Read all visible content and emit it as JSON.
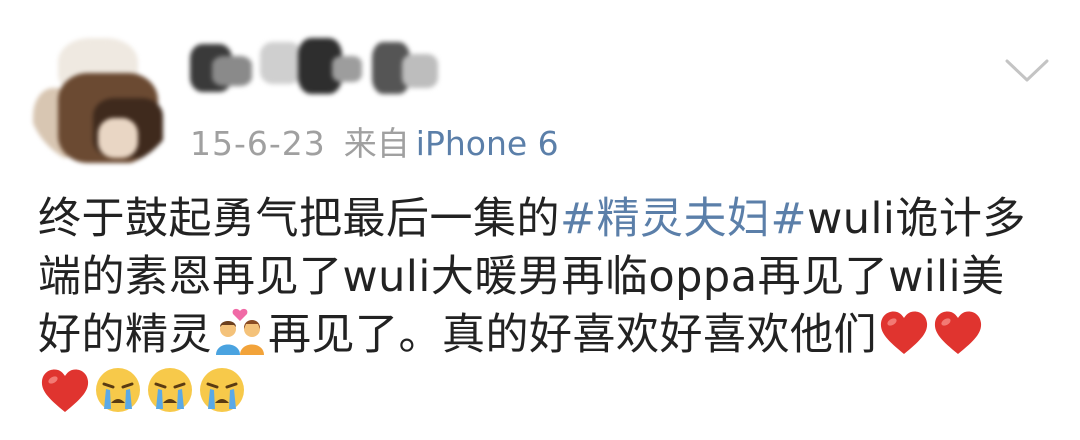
{
  "post": {
    "date": "15-6-23",
    "from_label": "来自",
    "device": "iPhone 6",
    "body": {
      "line1_before": "终于鼓起勇气把最后一集的",
      "tag": "#精灵夫妇#",
      "line1_after": "wuli诡计多",
      "line2": "端的素恩再见了wuli大暖男再临oppa再见了wili美",
      "line3_before": "好的精灵",
      "line3_after": "再见了。真的好喜欢好喜欢他们"
    },
    "emoji_names": [
      "couple-icon",
      "red-heart-icon",
      "crying-face-icon"
    ]
  },
  "colors": {
    "link": "#5b7fa9",
    "meta": "#a0a0a0",
    "text": "#222222",
    "heart": "#e0342f",
    "crying_face": "#f7c94a",
    "tears": "#5aa9e6"
  }
}
